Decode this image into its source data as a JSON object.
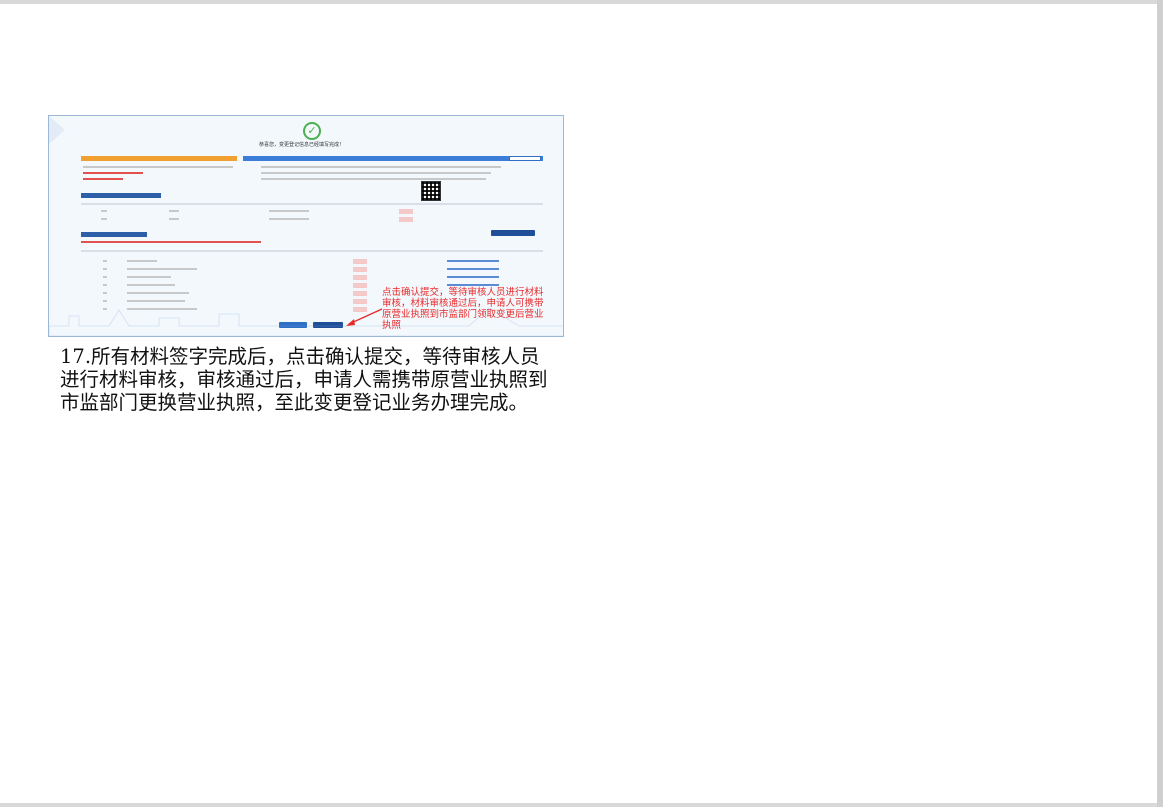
{
  "screenshot": {
    "success_text": "恭喜您，变更登记信息已经填写完成！",
    "callout_text": "点击确认提交，等待审核人员进行材料审核，材料审核通过后，申请人可携带原营业执照到市监部门领取变更后营业执照",
    "colors": {
      "accent": "#3b7dd8",
      "warning": "#f0a030",
      "callout": "#e82a2a",
      "check": "#4cb050"
    }
  },
  "caption": {
    "text": "17.所有材料签字完成后，点击确认提交，等待审核人员进行材料审核，审核通过后，申请人需携带原营业执照到市监部门更换营业执照，至此变更登记业务办理完成。"
  }
}
